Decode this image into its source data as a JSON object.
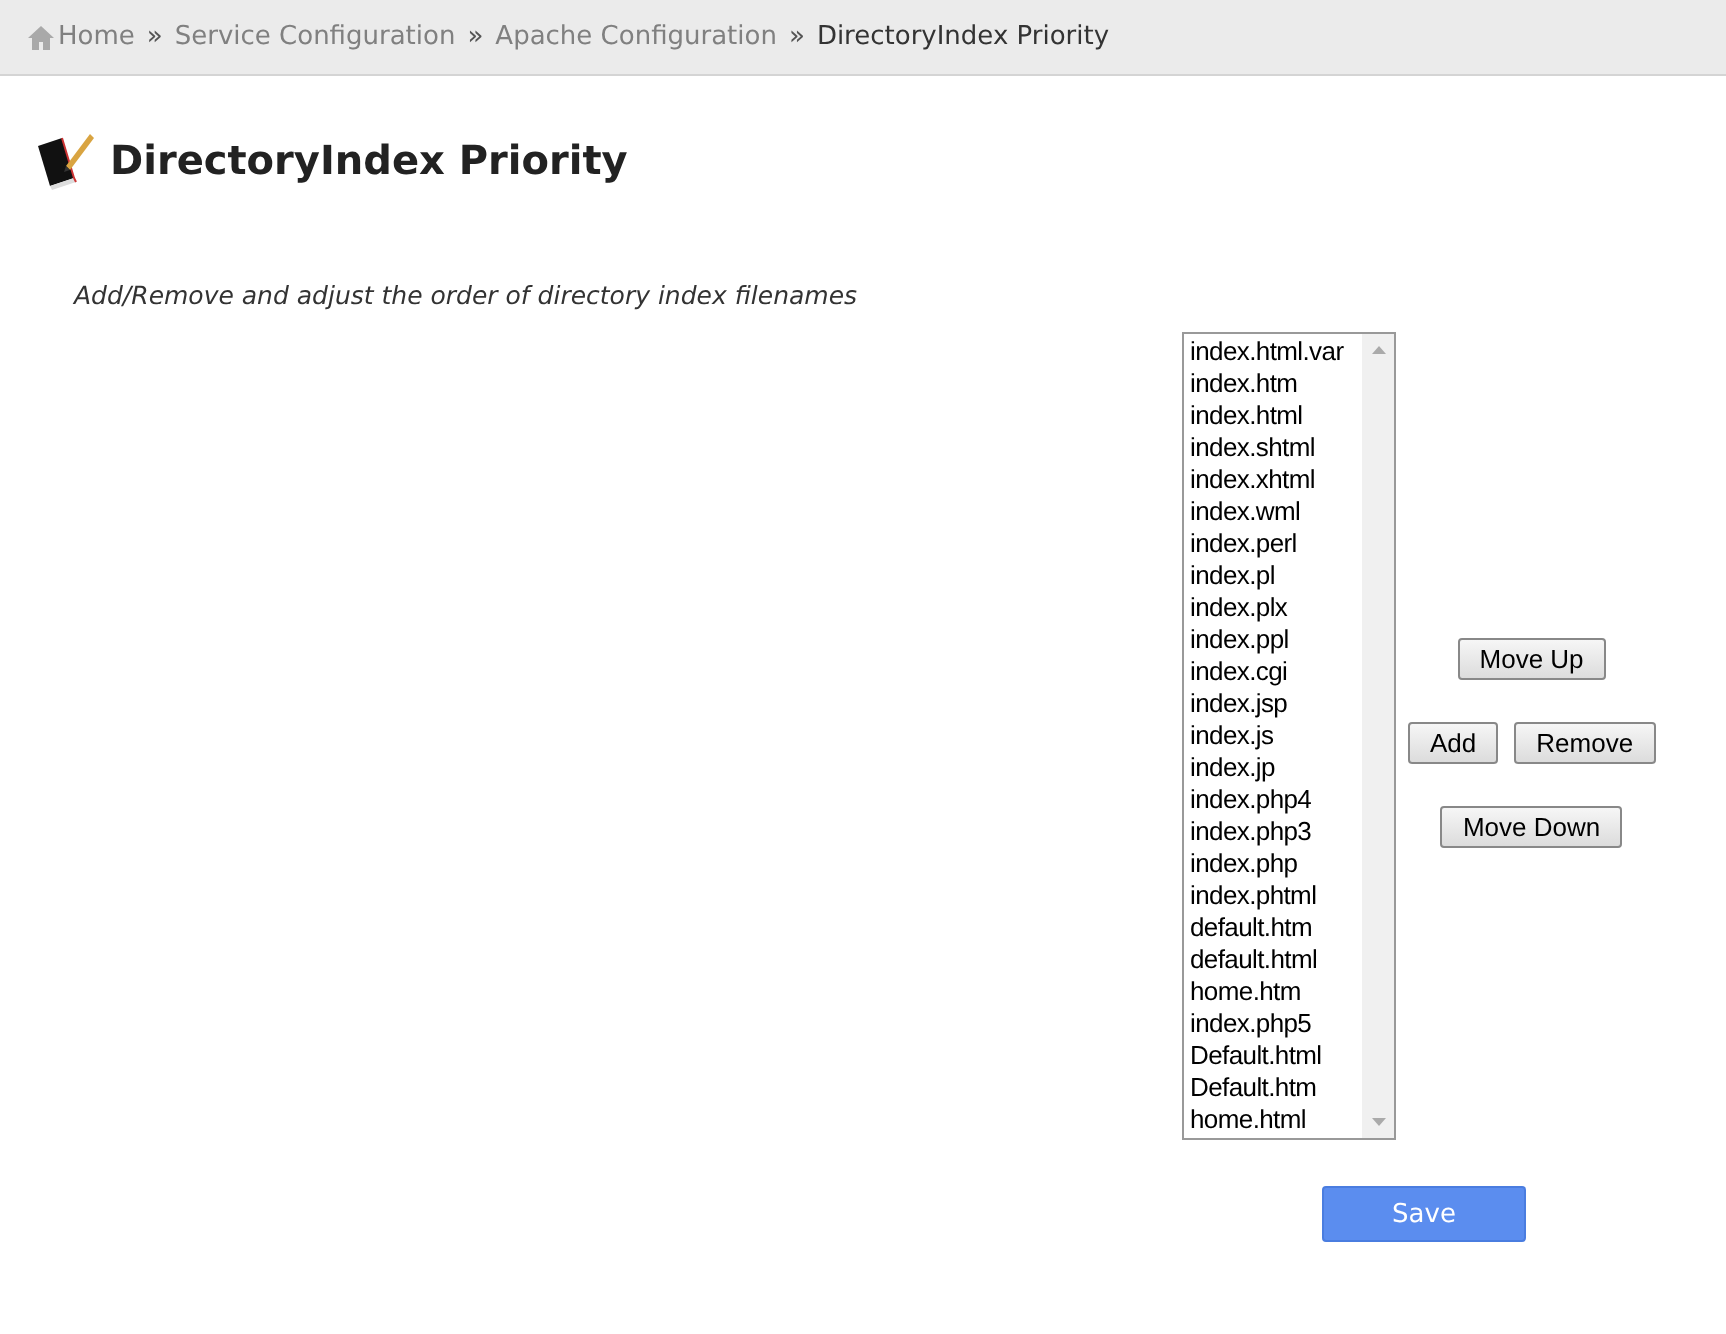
{
  "breadcrumb": [
    {
      "label": "Home",
      "current": false
    },
    {
      "label": "Service Configuration",
      "current": false
    },
    {
      "label": "Apache Configuration",
      "current": false
    },
    {
      "label": "DirectoryIndex Priority",
      "current": true
    }
  ],
  "breadcrumb_separator": "»",
  "title": "DirectoryIndex Priority",
  "description": "Add/Remove and adjust the order of directory index filenames",
  "filenames": [
    "index.html.var",
    "index.htm",
    "index.html",
    "index.shtml",
    "index.xhtml",
    "index.wml",
    "index.perl",
    "index.pl",
    "index.plx",
    "index.ppl",
    "index.cgi",
    "index.jsp",
    "index.js",
    "index.jp",
    "index.php4",
    "index.php3",
    "index.php",
    "index.phtml",
    "default.htm",
    "default.html",
    "home.htm",
    "index.php5",
    "Default.html",
    "Default.htm",
    "home.html"
  ],
  "buttons": {
    "move_up": "Move Up",
    "add": "Add",
    "remove": "Remove",
    "move_down": "Move Down"
  },
  "save": "Save"
}
